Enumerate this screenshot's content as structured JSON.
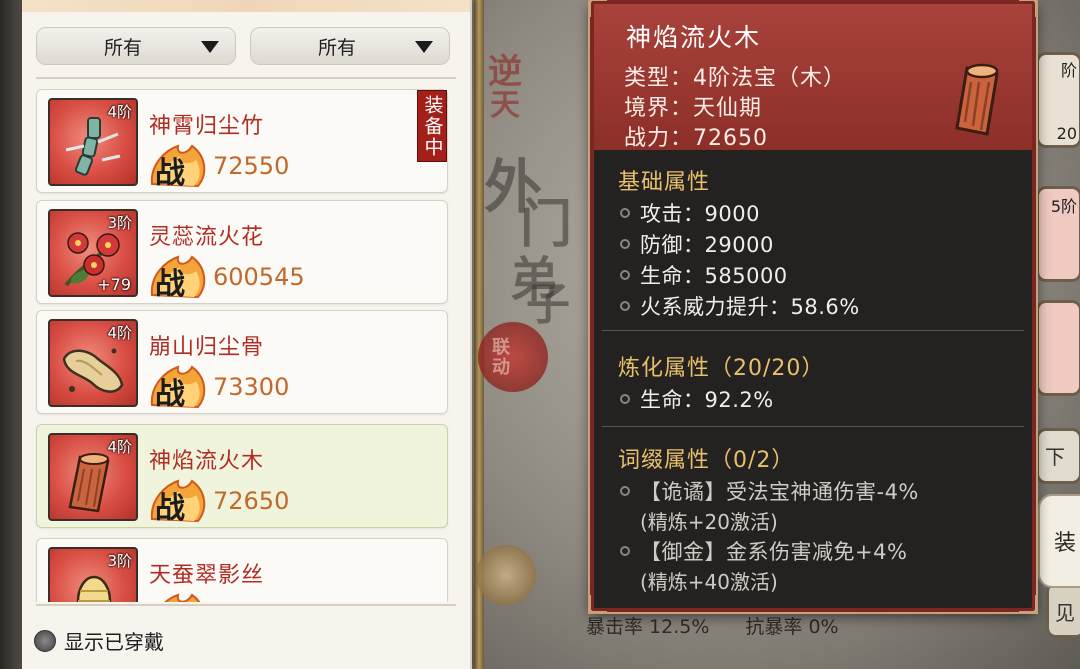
{
  "filters": {
    "left_value": "所有",
    "right_value": "所有"
  },
  "inventory": {
    "items": [
      {
        "name": "神霄归尘竹",
        "tier": "4阶",
        "power": "72550",
        "plus": "",
        "equipped_tag": "装备中",
        "art": "bamboo"
      },
      {
        "name": "灵蕊流火花",
        "tier": "3阶",
        "power": "600545",
        "plus": "+79",
        "equipped_tag": "",
        "art": "flower"
      },
      {
        "name": "崩山归尘骨",
        "tier": "4阶",
        "power": "73300",
        "plus": "",
        "equipped_tag": "",
        "art": "bone"
      },
      {
        "name": "神焰流火木",
        "tier": "4阶",
        "power": "72650",
        "plus": "",
        "equipped_tag": "",
        "art": "wood"
      },
      {
        "name": "天蚕翠影丝",
        "tier": "3阶",
        "power": "",
        "plus": "",
        "equipped_tag": "",
        "art": "silk"
      }
    ],
    "power_glyph": "战",
    "show_worn_label": "显示已穿戴"
  },
  "detail": {
    "title": "神焰流火木",
    "type_line": "类型：4阶法宝（木）",
    "realm_line": "境界：天仙期",
    "power_line": "战力：72650",
    "base_title": "基础属性",
    "base_attrs": [
      "攻击：9000",
      "防御：29000",
      "生命：585000",
      "火系威力提升：58.6%"
    ],
    "refine_title": "炼化属性（20/20）",
    "refine_attrs": [
      "生命：92.2%"
    ],
    "affix_title": "词缀属性（0/2）",
    "affixes": [
      {
        "text": "【诡谲】受法宝神通伤害-4%",
        "sub": "(精炼+20激活)"
      },
      {
        "text": "【御金】金系伤害减免+4%",
        "sub": "(精炼+40激活)"
      }
    ]
  },
  "background": {
    "bottom_stats": [
      "暴击率 12.5%",
      "抗暴率 0%"
    ],
    "equip_button": "装",
    "ink_chars": [
      "逆",
      "天",
      "外",
      "门",
      "弟",
      "子"
    ],
    "badge_text": "联动",
    "right_edge_labels": [
      "阶",
      "20",
      "5阶",
      "下",
      "见"
    ]
  },
  "colors": {
    "accent_red": "#b12d24",
    "power_orange": "#c0692a",
    "section_gold": "#e9c06a",
    "tooltip_header": "#a8423b"
  }
}
